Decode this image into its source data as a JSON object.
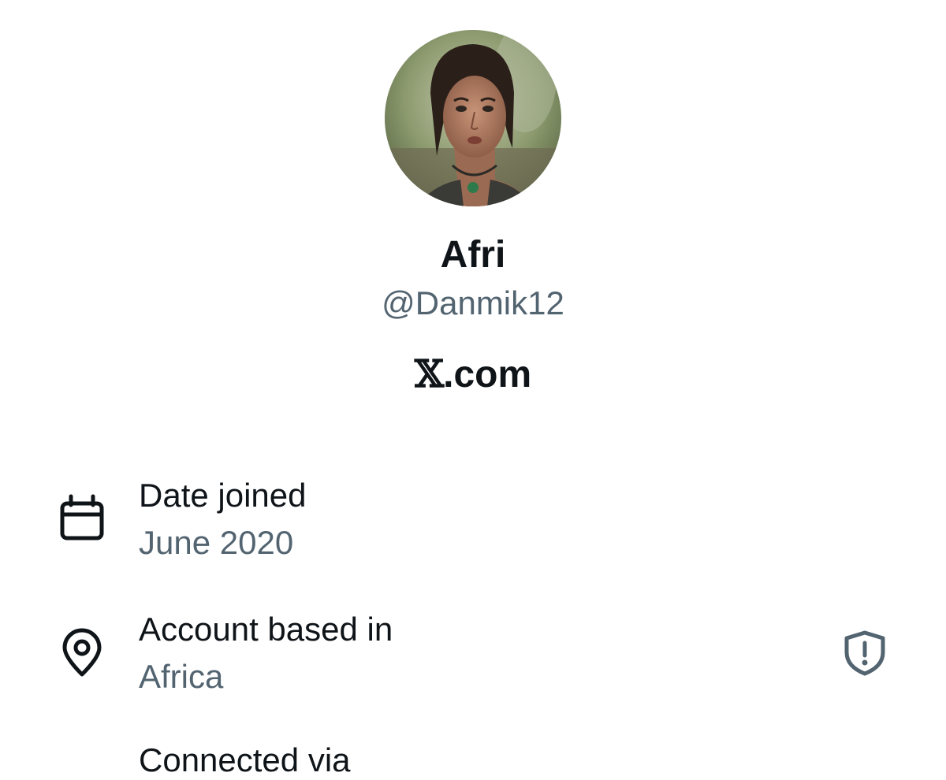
{
  "profile": {
    "display_name": "Afri",
    "handle": "@Danmik12",
    "site_mark": "𝕏",
    "site_suffix": ".com"
  },
  "details": [
    {
      "icon": "calendar-icon",
      "label": "Date joined",
      "value": "June 2020"
    },
    {
      "icon": "location-pin-icon",
      "label": "Account based in",
      "value": "Africa",
      "trailing_icon": "shield-alert-icon"
    },
    {
      "label": "Connected via"
    }
  ],
  "colors": {
    "primary_text": "#0f1419",
    "secondary_text": "#536471",
    "background": "#ffffff"
  }
}
